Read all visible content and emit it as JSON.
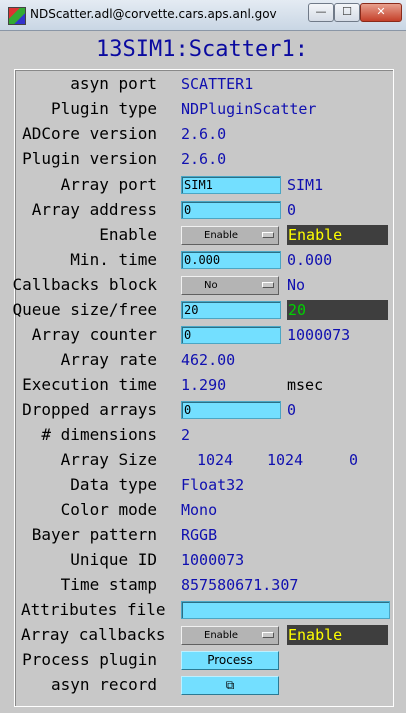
{
  "window": {
    "title": "NDScatter.adl@corvette.cars.aps.anl.gov",
    "minimize": "—",
    "maximize": "☐",
    "close": "✕"
  },
  "panel_title": "13SIM1:Scatter1:",
  "colors": {
    "title_blue": "#0a0aa0",
    "value_blue": "#1010b0",
    "input_cyan": "#73dfff",
    "status_yellow": "#ffff00",
    "status_green": "#00d000"
  },
  "rows": {
    "asyn_port": {
      "label": "asyn port",
      "value": "SCATTER1"
    },
    "plugin_type": {
      "label": "Plugin type",
      "value": "NDPluginScatter"
    },
    "adcore_version": {
      "label": "ADCore version",
      "value": "2.6.0"
    },
    "plugin_version": {
      "label": "Plugin version",
      "value": "2.6.0"
    },
    "array_port": {
      "label": "Array port",
      "input": "SIM1",
      "readback": "SIM1"
    },
    "array_address": {
      "label": "Array address",
      "input": "0",
      "readback": "0"
    },
    "enable": {
      "label": "Enable",
      "menu": "Enable",
      "readback": "Enable"
    },
    "min_time": {
      "label": "Min. time",
      "input": "0.000",
      "readback": "0.000"
    },
    "callbacks_block": {
      "label": "Callbacks block",
      "menu": "No",
      "readback": "No"
    },
    "queue_size": {
      "label": "Queue size/free",
      "input": "20",
      "readback": "20"
    },
    "array_counter": {
      "label": "Array counter",
      "input": "0",
      "readback": "1000073"
    },
    "array_rate": {
      "label": "Array rate",
      "value": "462.00"
    },
    "execution_time": {
      "label": "Execution time",
      "value": "1.290",
      "unit": "msec"
    },
    "dropped_arrays": {
      "label": "Dropped arrays",
      "input": "0",
      "readback": "0"
    },
    "dimensions": {
      "label": "# dimensions",
      "value": "2"
    },
    "array_size": {
      "label": "Array Size",
      "x": "1024",
      "y": "1024",
      "z": "0"
    },
    "data_type": {
      "label": "Data type",
      "value": "Float32"
    },
    "color_mode": {
      "label": "Color mode",
      "value": "Mono"
    },
    "bayer_pattern": {
      "label": "Bayer pattern",
      "value": "RGGB"
    },
    "unique_id": {
      "label": "Unique ID",
      "value": "1000073"
    },
    "time_stamp": {
      "label": "Time stamp",
      "value": "857580671.307"
    },
    "attributes_file": {
      "label": "Attributes file",
      "input": ""
    },
    "array_callbacks": {
      "label": "Array callbacks",
      "menu": "Enable",
      "readback": "Enable"
    },
    "process_plugin": {
      "label": "Process plugin",
      "button": "Process"
    },
    "asyn_record": {
      "label": "asyn record",
      "button_icon": "⧉"
    }
  }
}
